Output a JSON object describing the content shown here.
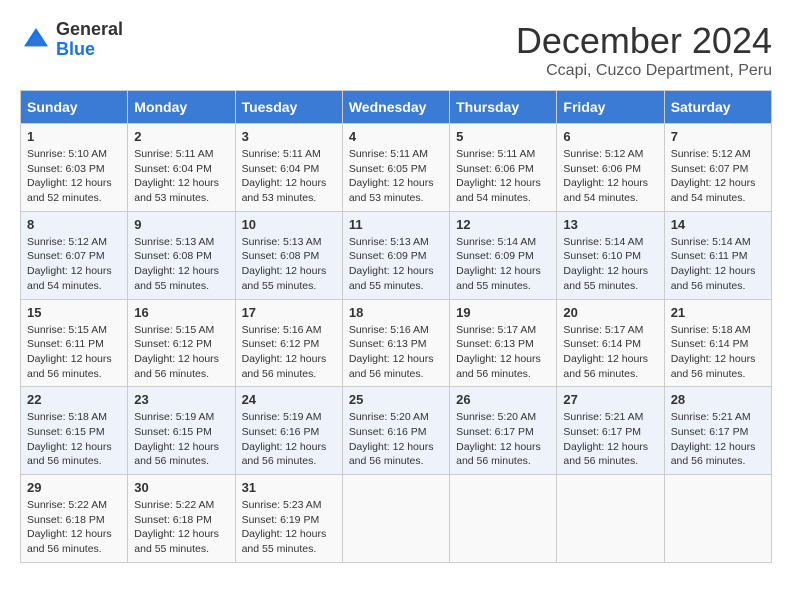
{
  "header": {
    "logo_general": "General",
    "logo_blue": "Blue",
    "title": "December 2024",
    "subtitle": "Ccapi, Cuzco Department, Peru"
  },
  "days_of_week": [
    "Sunday",
    "Monday",
    "Tuesday",
    "Wednesday",
    "Thursday",
    "Friday",
    "Saturday"
  ],
  "weeks": [
    [
      {
        "day": "1",
        "sunrise": "Sunrise: 5:10 AM",
        "sunset": "Sunset: 6:03 PM",
        "daylight": "Daylight: 12 hours and 52 minutes."
      },
      {
        "day": "2",
        "sunrise": "Sunrise: 5:11 AM",
        "sunset": "Sunset: 6:04 PM",
        "daylight": "Daylight: 12 hours and 53 minutes."
      },
      {
        "day": "3",
        "sunrise": "Sunrise: 5:11 AM",
        "sunset": "Sunset: 6:04 PM",
        "daylight": "Daylight: 12 hours and 53 minutes."
      },
      {
        "day": "4",
        "sunrise": "Sunrise: 5:11 AM",
        "sunset": "Sunset: 6:05 PM",
        "daylight": "Daylight: 12 hours and 53 minutes."
      },
      {
        "day": "5",
        "sunrise": "Sunrise: 5:11 AM",
        "sunset": "Sunset: 6:06 PM",
        "daylight": "Daylight: 12 hours and 54 minutes."
      },
      {
        "day": "6",
        "sunrise": "Sunrise: 5:12 AM",
        "sunset": "Sunset: 6:06 PM",
        "daylight": "Daylight: 12 hours and 54 minutes."
      },
      {
        "day": "7",
        "sunrise": "Sunrise: 5:12 AM",
        "sunset": "Sunset: 6:07 PM",
        "daylight": "Daylight: 12 hours and 54 minutes."
      }
    ],
    [
      {
        "day": "8",
        "sunrise": "Sunrise: 5:12 AM",
        "sunset": "Sunset: 6:07 PM",
        "daylight": "Daylight: 12 hours and 54 minutes."
      },
      {
        "day": "9",
        "sunrise": "Sunrise: 5:13 AM",
        "sunset": "Sunset: 6:08 PM",
        "daylight": "Daylight: 12 hours and 55 minutes."
      },
      {
        "day": "10",
        "sunrise": "Sunrise: 5:13 AM",
        "sunset": "Sunset: 6:08 PM",
        "daylight": "Daylight: 12 hours and 55 minutes."
      },
      {
        "day": "11",
        "sunrise": "Sunrise: 5:13 AM",
        "sunset": "Sunset: 6:09 PM",
        "daylight": "Daylight: 12 hours and 55 minutes."
      },
      {
        "day": "12",
        "sunrise": "Sunrise: 5:14 AM",
        "sunset": "Sunset: 6:09 PM",
        "daylight": "Daylight: 12 hours and 55 minutes."
      },
      {
        "day": "13",
        "sunrise": "Sunrise: 5:14 AM",
        "sunset": "Sunset: 6:10 PM",
        "daylight": "Daylight: 12 hours and 55 minutes."
      },
      {
        "day": "14",
        "sunrise": "Sunrise: 5:14 AM",
        "sunset": "Sunset: 6:11 PM",
        "daylight": "Daylight: 12 hours and 56 minutes."
      }
    ],
    [
      {
        "day": "15",
        "sunrise": "Sunrise: 5:15 AM",
        "sunset": "Sunset: 6:11 PM",
        "daylight": "Daylight: 12 hours and 56 minutes."
      },
      {
        "day": "16",
        "sunrise": "Sunrise: 5:15 AM",
        "sunset": "Sunset: 6:12 PM",
        "daylight": "Daylight: 12 hours and 56 minutes."
      },
      {
        "day": "17",
        "sunrise": "Sunrise: 5:16 AM",
        "sunset": "Sunset: 6:12 PM",
        "daylight": "Daylight: 12 hours and 56 minutes."
      },
      {
        "day": "18",
        "sunrise": "Sunrise: 5:16 AM",
        "sunset": "Sunset: 6:13 PM",
        "daylight": "Daylight: 12 hours and 56 minutes."
      },
      {
        "day": "19",
        "sunrise": "Sunrise: 5:17 AM",
        "sunset": "Sunset: 6:13 PM",
        "daylight": "Daylight: 12 hours and 56 minutes."
      },
      {
        "day": "20",
        "sunrise": "Sunrise: 5:17 AM",
        "sunset": "Sunset: 6:14 PM",
        "daylight": "Daylight: 12 hours and 56 minutes."
      },
      {
        "day": "21",
        "sunrise": "Sunrise: 5:18 AM",
        "sunset": "Sunset: 6:14 PM",
        "daylight": "Daylight: 12 hours and 56 minutes."
      }
    ],
    [
      {
        "day": "22",
        "sunrise": "Sunrise: 5:18 AM",
        "sunset": "Sunset: 6:15 PM",
        "daylight": "Daylight: 12 hours and 56 minutes."
      },
      {
        "day": "23",
        "sunrise": "Sunrise: 5:19 AM",
        "sunset": "Sunset: 6:15 PM",
        "daylight": "Daylight: 12 hours and 56 minutes."
      },
      {
        "day": "24",
        "sunrise": "Sunrise: 5:19 AM",
        "sunset": "Sunset: 6:16 PM",
        "daylight": "Daylight: 12 hours and 56 minutes."
      },
      {
        "day": "25",
        "sunrise": "Sunrise: 5:20 AM",
        "sunset": "Sunset: 6:16 PM",
        "daylight": "Daylight: 12 hours and 56 minutes."
      },
      {
        "day": "26",
        "sunrise": "Sunrise: 5:20 AM",
        "sunset": "Sunset: 6:17 PM",
        "daylight": "Daylight: 12 hours and 56 minutes."
      },
      {
        "day": "27",
        "sunrise": "Sunrise: 5:21 AM",
        "sunset": "Sunset: 6:17 PM",
        "daylight": "Daylight: 12 hours and 56 minutes."
      },
      {
        "day": "28",
        "sunrise": "Sunrise: 5:21 AM",
        "sunset": "Sunset: 6:17 PM",
        "daylight": "Daylight: 12 hours and 56 minutes."
      }
    ],
    [
      {
        "day": "29",
        "sunrise": "Sunrise: 5:22 AM",
        "sunset": "Sunset: 6:18 PM",
        "daylight": "Daylight: 12 hours and 56 minutes."
      },
      {
        "day": "30",
        "sunrise": "Sunrise: 5:22 AM",
        "sunset": "Sunset: 6:18 PM",
        "daylight": "Daylight: 12 hours and 55 minutes."
      },
      {
        "day": "31",
        "sunrise": "Sunrise: 5:23 AM",
        "sunset": "Sunset: 6:19 PM",
        "daylight": "Daylight: 12 hours and 55 minutes."
      },
      null,
      null,
      null,
      null
    ]
  ]
}
